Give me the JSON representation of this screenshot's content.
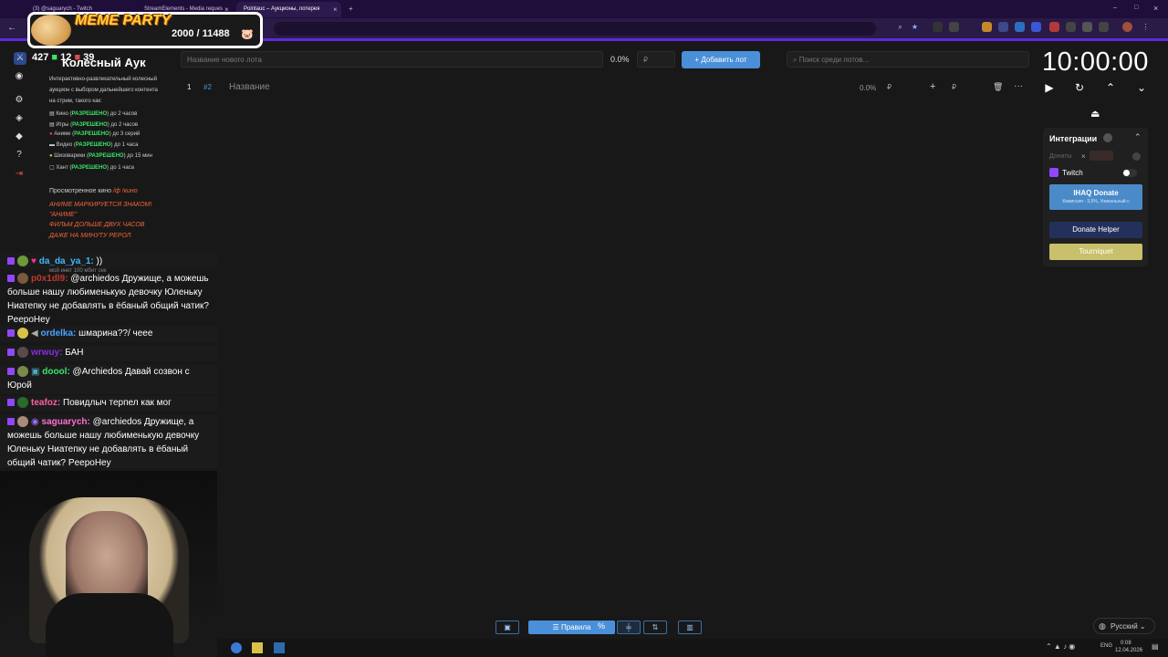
{
  "browser": {
    "tabs": [
      {
        "label": "(3) @saguarych - Twitch"
      },
      {
        "label": "StreamElements - Media reques"
      },
      {
        "label": "Pointauc – Аукционы, лотерея"
      }
    ],
    "new_tab": "+"
  },
  "overlay": {
    "title": "MEME PARTY",
    "count": "2000 / 11488"
  },
  "stream_stats": {
    "viewers": "427",
    "points": "12",
    "other": "39",
    "zero": "0"
  },
  "rules": {
    "title": "Колесный Аук",
    "intro_1": "Интерактивно-развлекательный колесный",
    "intro_2": "аукцион с выбором дальнейшего контента",
    "intro_3": "на стрим, такого как:",
    "items": [
      {
        "name": "Кино",
        "status": "РАЗРЕШЕНО",
        "limit": "до 2 часов"
      },
      {
        "name": "Игры",
        "status": "РАЗРЕШЕНО",
        "limit": "до 2 часов"
      },
      {
        "name": "Аниме",
        "status": "РАЗРЕШЕНО",
        "limit": "до 3 серий"
      },
      {
        "name": "Видео",
        "status": "РАЗРЕШЕНО",
        "limit": "до 1 часа"
      },
      {
        "name": "Шизоварики",
        "status": "РАЗРЕШЕНО",
        "limit": "до 15 мин"
      },
      {
        "name": "Хант",
        "status": "РАЗРЕШЕНО",
        "limit": "до 1 часа"
      }
    ],
    "watched_label": "Просмотренное кино",
    "watched_cmd": "/ф !кино",
    "warn_1": "АНИМЕ МАРКИРУЕТСЯ ЗНАКОМ!",
    "warn_2": "\"АНИМЕ\"",
    "warn_3": "ФИЛЬМ ДОЛЬШЕ ДВУХ ЧАСОВ",
    "warn_4": "ДАЖЕ НА МИНУТУ РЕРОЛ",
    "net_note": "мой инет 100 мбит сек"
  },
  "chat": [
    {
      "user": "da_da_ya_1:",
      "color": "#3db8ff",
      "text": " ))"
    },
    {
      "user": "p0x1dl9:",
      "color": "#c0392b",
      "text": " @archiedos Дружище, а можешь больше нашу любименькую девочку Юленьку Ниатепку не добавлять в ёбаный общий чатик? PeepoHey"
    },
    {
      "user": "ordelka:",
      "color": "#4aa3ff",
      "text": " шмарина??/ чеее"
    },
    {
      "user": "wrwuy:",
      "color": "#8a2be2",
      "text": " БАН"
    },
    {
      "user": "doool:",
      "color": "#3ce36b",
      "text": " @Archiedos Давай созвон с Юрой"
    },
    {
      "user": "teafoz:",
      "color": "#ff5fa2",
      "text": " Повидлыч терпел как мог"
    },
    {
      "user": "saguarych:",
      "color": "#ff6fd1",
      "text": " @archiedos Дружище, а можешь больше нашу любименькую девочку Юленьку Ниатепку не добавлять в ёбаный общий чатик? PeepoHey"
    }
  ],
  "auction": {
    "new_lot_placeholder": "Название нового лота",
    "percent": "0.0%",
    "currency": "₽",
    "add_lot": "Добавить лот",
    "search_placeholder": "Поиск среди лотов...",
    "row_index": "1",
    "row_id": "#2",
    "row_name_placeholder": "Название",
    "row_percent": "0.0%",
    "row_currency": "₽",
    "row_plus": "+",
    "row_more": "···"
  },
  "timer": {
    "value": "10:00:00"
  },
  "integrations": {
    "title": "Интеграции",
    "donations_label": "Донаты",
    "twitch_label": "Twitch",
    "ihaq_title": "IHAQ Donate",
    "ihaq_sub": "Комиссия - 3,5%, Уникальный с",
    "donate_helper": "Donate Helper",
    "tourniquet": "Tourniquet"
  },
  "bottom_bar": {
    "rules": "Правила",
    "percent_icon": "%"
  },
  "language": {
    "selected": "Русский"
  },
  "tray": {
    "lang": "ENG",
    "time": "0:08",
    "date": "12.04.2026"
  },
  "colors": {
    "accent": "#4a90d9",
    "browser_tab": "#1f0d3a",
    "allowed": "#3ce36b",
    "warning": "#f0663a",
    "tourniquet": "#c8c06a",
    "donate_helper": "#23305c"
  }
}
